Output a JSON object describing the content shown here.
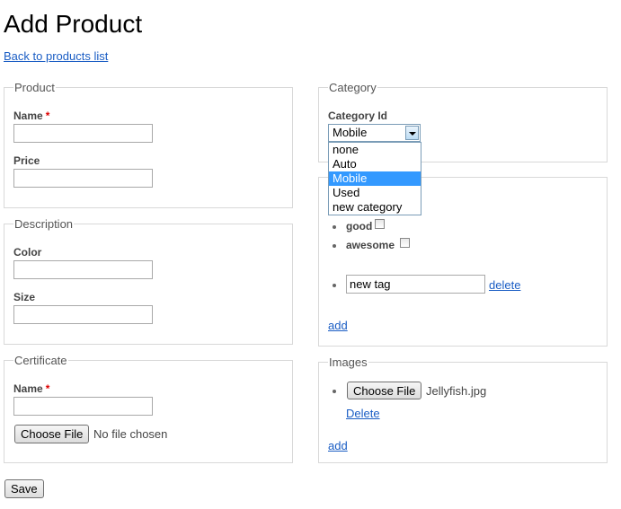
{
  "page": {
    "title": "Add Product",
    "back_link": "Back to products list"
  },
  "product": {
    "legend": "Product",
    "name_label": "Name",
    "required_mark": "*",
    "name_value": "",
    "price_label": "Price",
    "price_value": ""
  },
  "description": {
    "legend": "Description",
    "color_label": "Color",
    "color_value": "",
    "size_label": "Size",
    "size_value": ""
  },
  "certificate": {
    "legend": "Certificate",
    "name_label": "Name",
    "required_mark": "*",
    "name_value": "",
    "choose_file_label": "Choose File",
    "file_status": "No file chosen"
  },
  "category": {
    "legend": "Category",
    "field_label": "Category Id",
    "selected": "Mobile",
    "options": [
      "none",
      "Auto",
      "Mobile",
      "Used",
      "new category"
    ]
  },
  "tags": {
    "items": [
      {
        "label": "good",
        "checked": false
      },
      {
        "label": "awesome",
        "checked": false
      }
    ],
    "new_tag_value": "new tag",
    "delete_label": "delete",
    "add_label": "add"
  },
  "images": {
    "legend": "Images",
    "choose_file_label": "Choose File",
    "file_name": "Jellyfish.jpg",
    "delete_label": "Delete",
    "add_label": "add"
  },
  "actions": {
    "save_label": "Save"
  }
}
